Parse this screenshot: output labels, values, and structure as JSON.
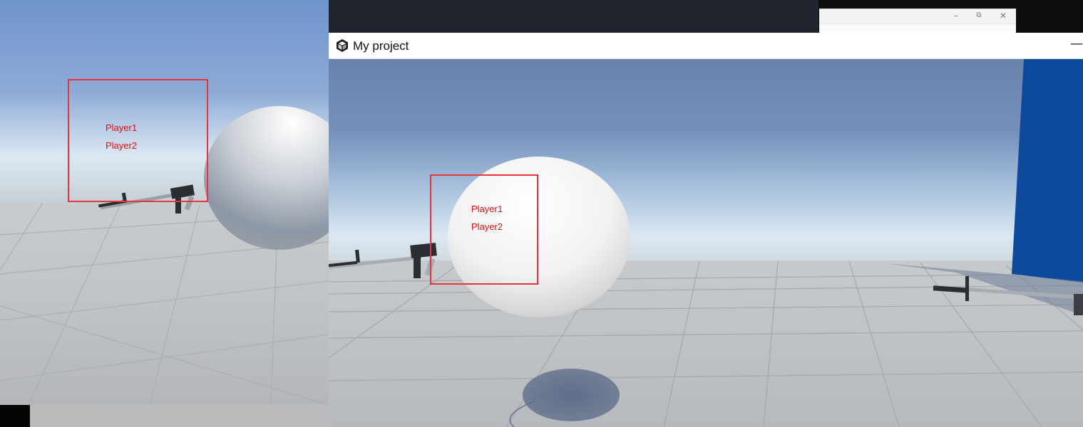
{
  "back_window": {
    "player_list": [
      "Player1",
      "Player2"
    ]
  },
  "main_window": {
    "title": "My project",
    "minimize_glyph": "—",
    "player_list": [
      "Player1",
      "Player2"
    ]
  },
  "background_window": {
    "minimize_glyph": "–",
    "restore_glyph": "⧉",
    "close_glyph": "✕"
  },
  "colors": {
    "debug_box": "#e8343a",
    "player_label": "#e01010",
    "wall": "#0d4a9b"
  },
  "icons": [
    "unity-logo-icon"
  ]
}
